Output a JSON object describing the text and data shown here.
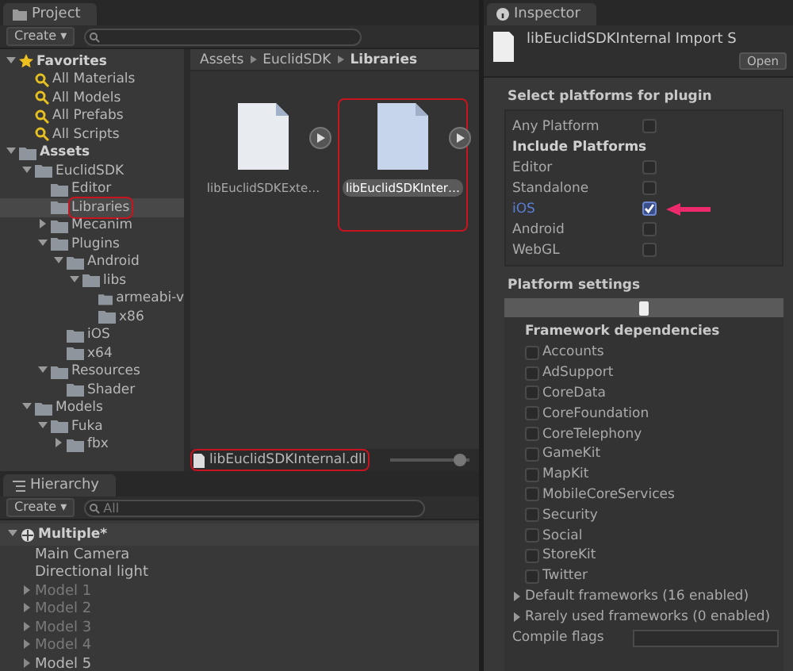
{
  "project": {
    "tab": "Project",
    "create": "Create ▾",
    "tree": [
      {
        "label": "Favorites",
        "kind": "favorites",
        "expanded": true,
        "selected": false,
        "highlighted": false,
        "children": [
          {
            "label": "All Materials",
            "kind": "search",
            "selected": false,
            "highlighted": false
          },
          {
            "label": "All Models",
            "kind": "search",
            "selected": false,
            "highlighted": false
          },
          {
            "label": "All Prefabs",
            "kind": "search",
            "selected": false,
            "highlighted": false
          },
          {
            "label": "All Scripts",
            "kind": "search",
            "selected": false,
            "highlighted": false
          }
        ]
      },
      {
        "label": "Assets",
        "kind": "root",
        "expanded": true,
        "selected": false,
        "highlighted": false,
        "children": [
          {
            "label": "EuclidSDK",
            "kind": "folder",
            "expanded": true,
            "selected": false,
            "highlighted": false,
            "children": [
              {
                "label": "Editor",
                "kind": "folder",
                "selected": false,
                "highlighted": false
              },
              {
                "label": "Libraries",
                "kind": "folder",
                "selected": true,
                "highlighted": true
              },
              {
                "label": "Mecanim",
                "kind": "folder",
                "expanded": false,
                "selected": false,
                "highlighted": false
              },
              {
                "label": "Plugins",
                "kind": "folder",
                "expanded": true,
                "selected": false,
                "highlighted": false,
                "children": [
                  {
                    "label": "Android",
                    "kind": "folder",
                    "expanded": true,
                    "selected": false,
                    "highlighted": false,
                    "children": [
                      {
                        "label": "libs",
                        "kind": "folder",
                        "expanded": true,
                        "selected": false,
                        "highlighted": false,
                        "children": [
                          {
                            "label": "armeabi-v",
                            "kind": "folder",
                            "selected": false,
                            "highlighted": false
                          },
                          {
                            "label": "x86",
                            "kind": "folder",
                            "selected": false,
                            "highlighted": false
                          }
                        ]
                      }
                    ]
                  },
                  {
                    "label": "iOS",
                    "kind": "folder",
                    "selected": false,
                    "highlighted": false
                  },
                  {
                    "label": "x64",
                    "kind": "folder",
                    "selected": false,
                    "highlighted": false
                  }
                ]
              },
              {
                "label": "Resources",
                "kind": "folder",
                "expanded": true,
                "selected": false,
                "highlighted": false,
                "children": [
                  {
                    "label": "Shader",
                    "kind": "folder",
                    "selected": false,
                    "highlighted": false
                  }
                ]
              }
            ]
          },
          {
            "label": "Models",
            "kind": "folder",
            "expanded": true,
            "selected": false,
            "highlighted": false,
            "children": [
              {
                "label": "Fuka",
                "kind": "folder",
                "expanded": true,
                "selected": false,
                "highlighted": false,
                "children": [
                  {
                    "label": "fbx",
                    "kind": "folder",
                    "expanded": false,
                    "selected": false,
                    "highlighted": false
                  }
                ]
              }
            ]
          }
        ]
      }
    ],
    "breadcrumb": [
      "Assets",
      "EuclidSDK",
      "Libraries"
    ],
    "assets": [
      {
        "name": "libEuclidSDKExte…",
        "selected": false,
        "highlighted": false
      },
      {
        "name": "libEuclidSDKInter…",
        "selected": true,
        "highlighted": true
      }
    ],
    "path": {
      "text": "libEuclidSDKInternal.dll",
      "highlighted": true
    },
    "zoom": {
      "level": 0.88
    }
  },
  "hierarchy": {
    "tab": "Hierarchy",
    "create": "Create ▾",
    "search": {
      "placeholder": "All"
    },
    "scene": "Multiple*",
    "rows": [
      {
        "label": "Main Camera",
        "disabled": false,
        "expandable": false
      },
      {
        "label": "Directional light",
        "disabled": false,
        "expandable": false
      },
      {
        "label": "Model 1",
        "disabled": true,
        "expandable": true
      },
      {
        "label": "Model 2",
        "disabled": true,
        "expandable": true
      },
      {
        "label": "Model 3",
        "disabled": true,
        "expandable": true
      },
      {
        "label": "Model 4",
        "disabled": true,
        "expandable": true
      },
      {
        "label": "Model 5",
        "disabled": false,
        "expandable": true
      }
    ]
  },
  "inspector": {
    "tab": "Inspector",
    "title": "libEuclidSDKInternal Import S",
    "open": "Open",
    "select_heading": "Select platforms for plugin",
    "any_platform": {
      "label": "Any Platform",
      "checked": false
    },
    "include_heading": "Include Platforms",
    "platforms": [
      {
        "label": "Editor",
        "checked": false,
        "selected": false
      },
      {
        "label": "Standalone",
        "checked": false,
        "selected": false
      },
      {
        "label": "iOS",
        "checked": true,
        "selected": true
      },
      {
        "label": "Android",
        "checked": false,
        "selected": false
      },
      {
        "label": "WebGL",
        "checked": false,
        "selected": false
      }
    ],
    "settings_heading": "Platform settings",
    "frameworks_heading": "Framework dependencies",
    "frameworks": [
      {
        "label": "Accounts",
        "checked": false
      },
      {
        "label": "AdSupport",
        "checked": false
      },
      {
        "label": "CoreData",
        "checked": false
      },
      {
        "label": "CoreFoundation",
        "checked": false
      },
      {
        "label": "CoreTelephony",
        "checked": false
      },
      {
        "label": "GameKit",
        "checked": false
      },
      {
        "label": "MapKit",
        "checked": false
      },
      {
        "label": "MobileCoreServices",
        "checked": false
      },
      {
        "label": "Security",
        "checked": false
      },
      {
        "label": "Social",
        "checked": false
      },
      {
        "label": "StoreKit",
        "checked": false
      },
      {
        "label": "Twitter",
        "checked": false
      }
    ],
    "foldouts": [
      {
        "label": "Default frameworks (16 enabled)",
        "expanded": false
      },
      {
        "label": "Rarely used frameworks (0 enabled)",
        "expanded": false
      }
    ],
    "compile_flags": {
      "label": "Compile flags"
    }
  }
}
